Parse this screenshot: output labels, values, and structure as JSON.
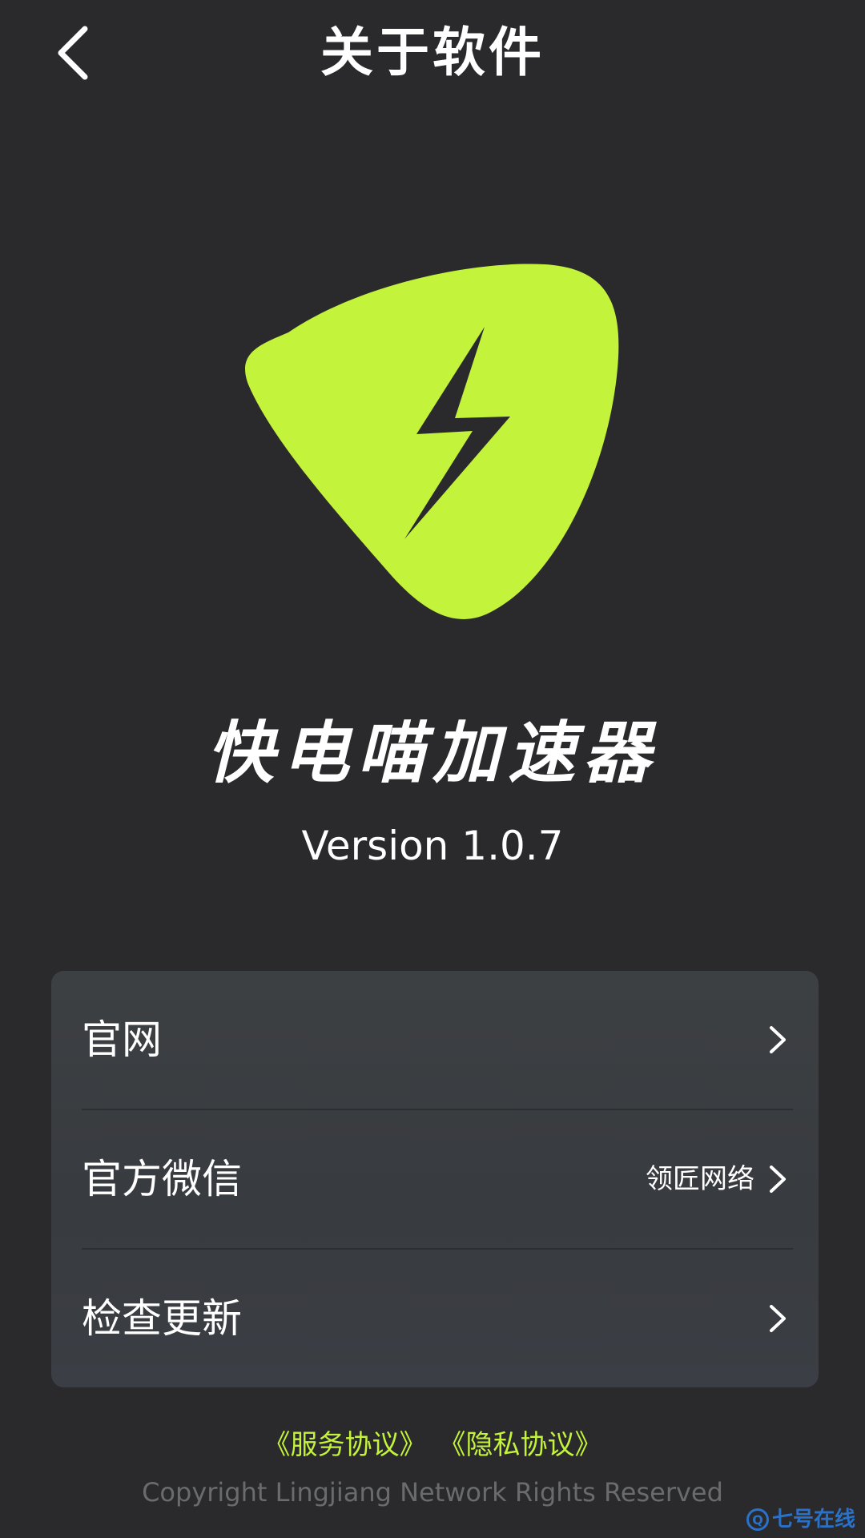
{
  "header": {
    "title": "关于软件",
    "back_icon": "chevron-left-icon"
  },
  "logo": {
    "icon": "lightning-bolt-icon",
    "shape_color": "#c3f33a",
    "bolt_color": "#2a2a2c"
  },
  "app": {
    "name": "快电喵加速器",
    "version": "Version 1.0.7"
  },
  "menu": {
    "items": [
      {
        "label": "官网",
        "value": "",
        "icon": "chevron-right-icon"
      },
      {
        "label": "官方微信",
        "value": "领匠网络",
        "icon": "chevron-right-icon"
      },
      {
        "label": "检查更新",
        "value": "",
        "icon": "chevron-right-icon"
      }
    ]
  },
  "footer": {
    "service_agreement": "《服务协议》",
    "privacy_agreement": "《隐私协议》",
    "copyright": "Copyright Lingjiang Network Rights Reserved"
  },
  "watermark": {
    "badge": "Q",
    "text": "七号在线"
  },
  "colors": {
    "background": "#2a2a2c",
    "card": "#3b3e42",
    "accent": "#c3f33a",
    "muted": "#6a6b6e",
    "watermark": "#2a72c9"
  }
}
